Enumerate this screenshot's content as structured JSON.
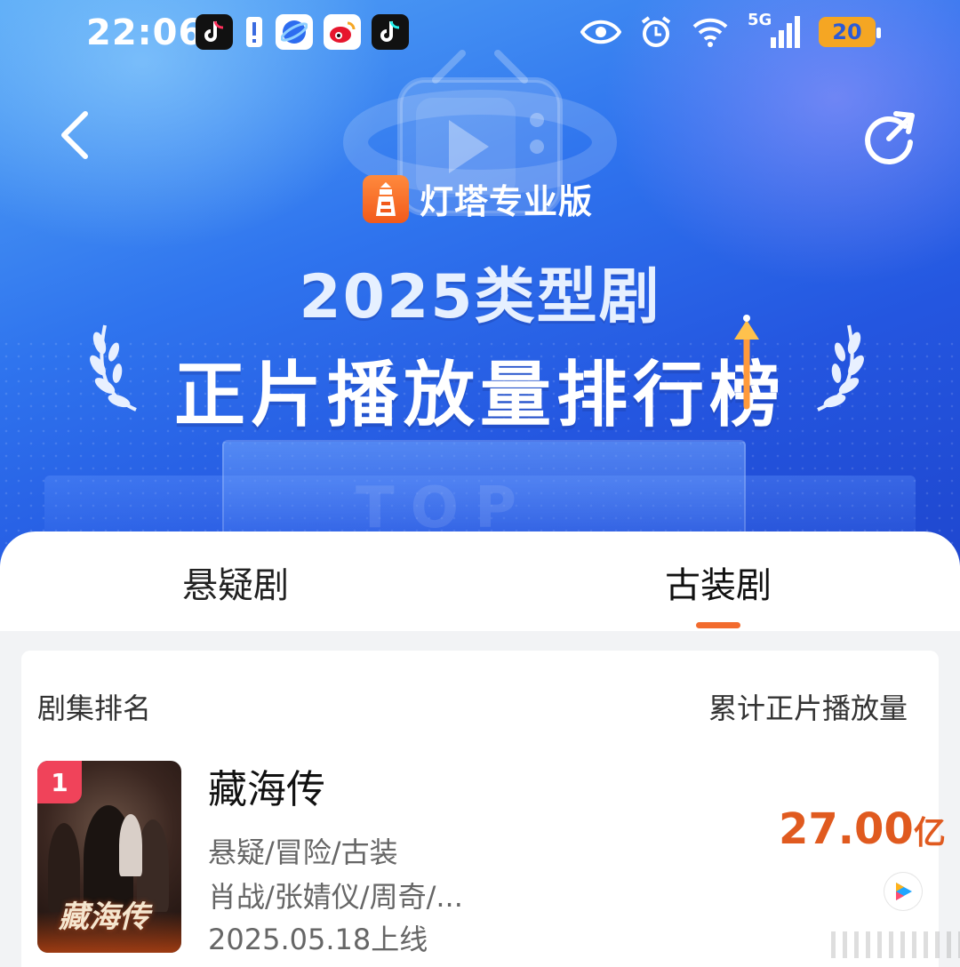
{
  "status_bar": {
    "time": "22:06",
    "apps": [
      "tiktok-icon",
      "alert-icon",
      "browser-icon",
      "weibo-icon",
      "tiktok-icon"
    ],
    "network": "5G",
    "battery": "20"
  },
  "header": {
    "brand": "灯塔专业版",
    "title_line1": "2025类型剧",
    "title_line2": "正片播放量排行榜",
    "bg_watermark": "TOP"
  },
  "tabs": [
    {
      "label": "悬疑剧",
      "active": false
    },
    {
      "label": "古装剧",
      "active": true
    }
  ],
  "table": {
    "col_left": "剧集排名",
    "col_right": "累计正片播放量"
  },
  "items": [
    {
      "rank": "1",
      "title": "藏海传",
      "genres": "悬疑/冒险/古装",
      "cast": "肖战/张婧仪/周奇/...",
      "release": "2025.05.18上线",
      "plays_value": "27.00",
      "plays_unit": "亿",
      "poster_text": "藏海传"
    }
  ],
  "colors": {
    "accent_orange": "#e05a1f",
    "rank_badge": "#f0435a",
    "hero_blue": "#2f74ee"
  }
}
